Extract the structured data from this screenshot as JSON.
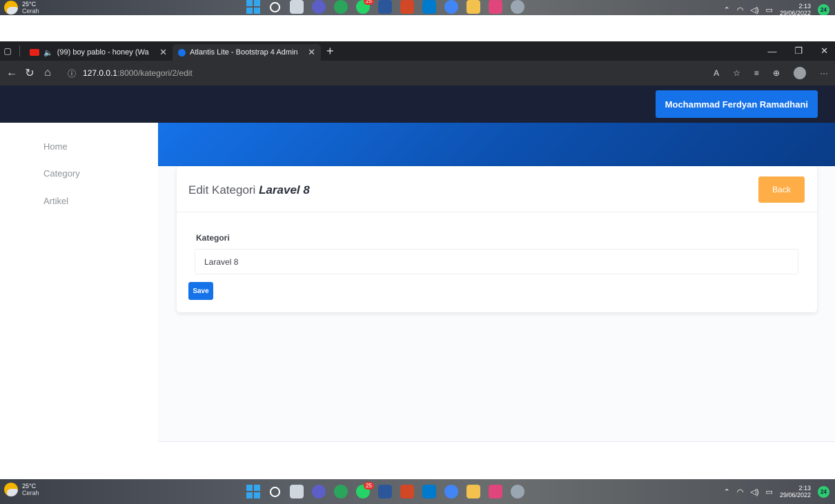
{
  "taskbar": {
    "weather_temp": "25°C",
    "weather_cond": "Cerah",
    "time": "2:13",
    "date": "29/06/2022",
    "notifications": "24",
    "whatsapp_badge": "25"
  },
  "browser": {
    "tabs": [
      {
        "title": "(99) boy pablo - honey (Wa",
        "favicon_color": "#e62117"
      },
      {
        "title": "Atlantis Lite - Bootstrap 4 Admin",
        "favicon_color": "#1572e8"
      }
    ],
    "url_host": "127.0.0.1",
    "url_path": ":8000/kategori/2/edit"
  },
  "navbar": {
    "user_name": "Mochammad Ferdyan Ramadhani"
  },
  "sidebar": {
    "items": [
      {
        "label": "Home"
      },
      {
        "label": "Category"
      },
      {
        "label": "Artikel"
      }
    ]
  },
  "card": {
    "title_prefix": "Edit Kategori",
    "title_name": "Laravel 8",
    "back_label": "Back",
    "field_label": "Kategori",
    "field_value": "Laravel 8",
    "save_label": "Save"
  },
  "colors": {
    "navbar": "#1a2035",
    "primary": "#1572e8",
    "warning": "#ffad46"
  }
}
